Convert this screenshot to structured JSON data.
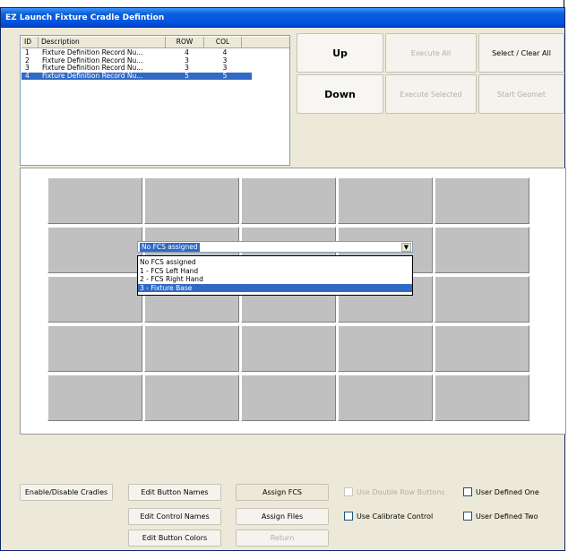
{
  "window": {
    "title": "EZ Launch Fixture Cradle Defintion"
  },
  "fixture_list": {
    "columns": [
      "ID",
      "Description",
      "ROW",
      "COL"
    ],
    "rows": [
      {
        "id": "1",
        "description": "Fixture Definition Record Nu...",
        "row": "4",
        "col": "4",
        "selected": false
      },
      {
        "id": "2",
        "description": "Fixture Definition Record Nu...",
        "row": "3",
        "col": "3",
        "selected": false
      },
      {
        "id": "3",
        "description": "Fixture Definition Record Nu...",
        "row": "3",
        "col": "3",
        "selected": false
      },
      {
        "id": "4",
        "description": "Fixture Definition Record Nu...",
        "row": "5",
        "col": "5",
        "selected": true
      }
    ]
  },
  "top_buttons": {
    "up": "Up",
    "down": "Down",
    "execute_all": "Execute All",
    "execute_selected": "Execute Selected",
    "select_clear_all": "Select / Clear All",
    "start_geomet": "Start Geomet"
  },
  "cradle_grid": {
    "rows": 5,
    "cols": 5
  },
  "fcs_dropdown": {
    "value": "No FCS assigned",
    "options": [
      "No FCS assigned",
      "1  -  FCS Left Hand",
      "2  -  FCS Right Hand",
      "3  -  Fixture Base"
    ],
    "highlighted_index": 3
  },
  "bottom_buttons": {
    "enable_disable_cradles": "Enable/Disable Cradles",
    "edit_button_names": "Edit Button Names",
    "edit_control_names": "Edit Control  Names",
    "edit_button_colors": "Edit Button Colors",
    "assign_fcs": "Assign FCS",
    "assign_files": "Assign Files",
    "return": "Return"
  },
  "checkboxes": {
    "use_double_row_buttons": {
      "label": "Use Double Row Buttons",
      "checked": false,
      "enabled": false
    },
    "use_calibrate_control": {
      "label": "Use Calibrate Control",
      "checked": false,
      "enabled": true
    },
    "user_defined_one": {
      "label": "User Defined One",
      "checked": false,
      "enabled": true
    },
    "user_defined_two": {
      "label": "User Defined Two",
      "checked": false,
      "enabled": true
    }
  }
}
